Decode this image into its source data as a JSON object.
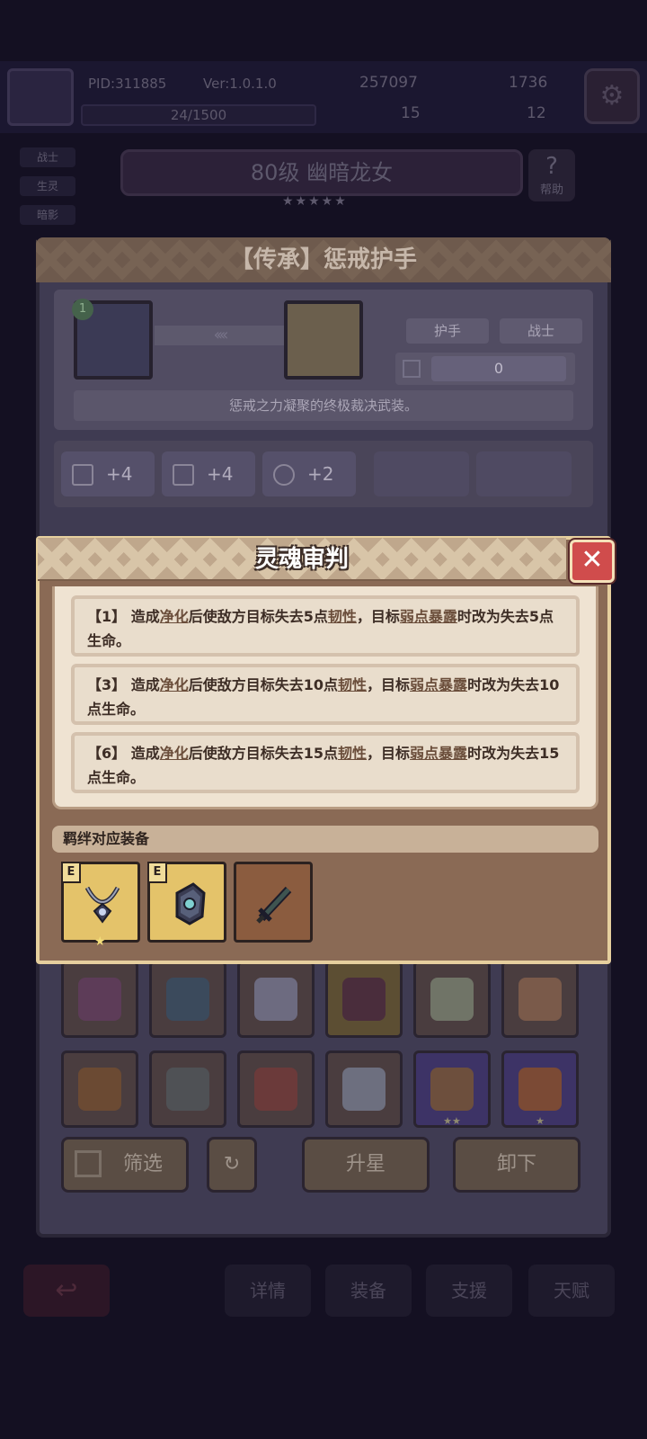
{
  "background": {
    "pid": "PID:311885",
    "version": "Ver:1.0.1.0",
    "currency_1": "257097",
    "currency_2": "1736",
    "exp": "24/1500",
    "currency_3": "15",
    "currency_4": "12",
    "side_tabs": [
      "战士",
      "生灵",
      "暗影"
    ],
    "hero_title": "80级  幽暗龙女",
    "hero_stars": "★★★★★",
    "help_label": "帮助",
    "nav": [
      "详情",
      "装备",
      "支援",
      "天赋"
    ]
  },
  "panel": {
    "title": "【传承】惩戒护手",
    "hero_level": "1",
    "tag_slot": "护手",
    "tag_class": "战士",
    "count": "0",
    "description": "惩戒之力凝聚的终极裁决武装。",
    "stats": [
      {
        "icon": "shield-icon",
        "value": "+4"
      },
      {
        "icon": "book-icon",
        "value": "+4"
      },
      {
        "icon": "heart-icon",
        "value": "+2"
      }
    ],
    "buttons": {
      "filter": "筛选",
      "star_up": "升星",
      "unequip": "卸下"
    }
  },
  "popup": {
    "title": "灵魂审判",
    "close_glyph": "✕",
    "skills": [
      {
        "prefix": "【1】 造成",
        "k1": "净化",
        "mid1": "后使敌方目标失去5点",
        "k2": "韧性",
        "mid2": "，目标",
        "k3": "弱点暴露",
        "suffix": "时改为失去5点生命。"
      },
      {
        "prefix": "【3】 造成",
        "k1": "净化",
        "mid1": "后使敌方目标失去10点",
        "k2": "韧性",
        "mid2": "，目标",
        "k3": "弱点暴露",
        "suffix": "时改为失去10点生命。"
      },
      {
        "prefix": "【6】 造成",
        "k1": "净化",
        "mid1": "后使敌方目标失去15点",
        "k2": "韧性",
        "mid2": "，目标",
        "k3": "弱点暴露",
        "suffix": "时改为失去15点生命。"
      }
    ],
    "bond_label": "羁绊对应装备",
    "bond_badge": "E",
    "bond_star": "★"
  },
  "colors": {
    "accent_red": "#d04c4c",
    "popup_border": "#e6cf9e",
    "parchment": "#efe3d2"
  }
}
